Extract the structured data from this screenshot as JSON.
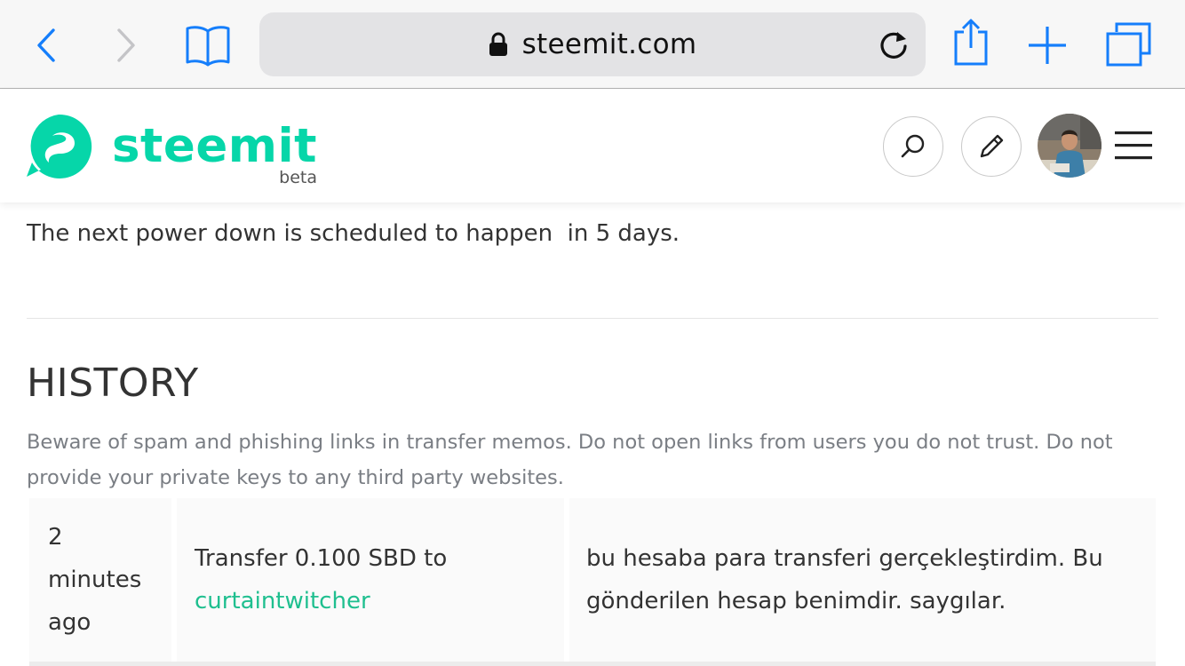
{
  "browser": {
    "url": "steemit.com",
    "icons": [
      "back-icon",
      "forward-icon",
      "bookmarks-icon",
      "lock-icon",
      "reload-icon",
      "share-icon",
      "new-tab-icon",
      "tabs-icon"
    ]
  },
  "header": {
    "brand_name": "steemit",
    "brand_tag": "beta",
    "icons": [
      "search-icon",
      "pencil-icon",
      "avatar",
      "hamburger-menu-icon"
    ],
    "accent_color": "#06d6a9"
  },
  "main": {
    "power_down_text": "The next power down is scheduled to happen  in 5 days.",
    "history_title": "HISTORY",
    "warning_text": "Beware of spam and phishing links in transfer memos. Do not open links from users you do not trust. Do not provide your private keys to any third party websites.",
    "history_rows": [
      {
        "time_line1": "2",
        "time_line2": "minutes",
        "time_line3": "ago",
        "action_text": "Transfer 0.100 SBD to",
        "action_link": "curtaintwitcher",
        "memo": "bu hesaba para transferi gerçekleştirdim. Bu gönderilen hesap benimdir. saygılar."
      }
    ],
    "link_color": "#1fbf8f"
  }
}
